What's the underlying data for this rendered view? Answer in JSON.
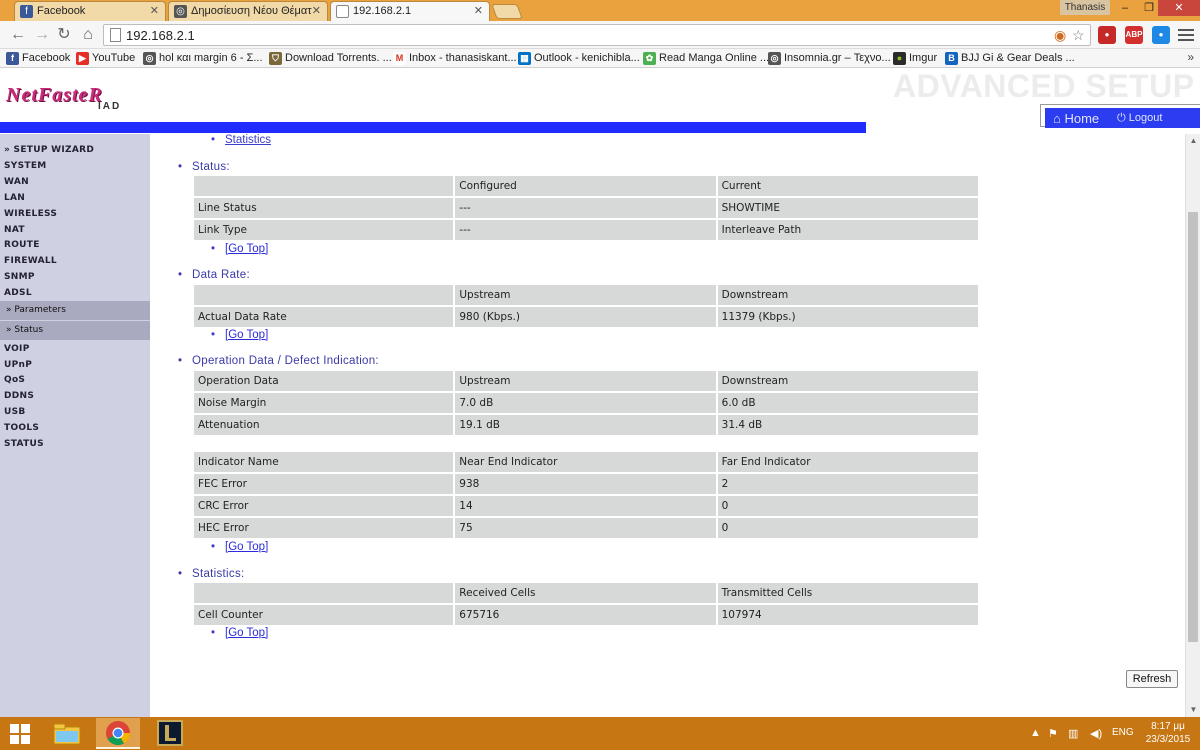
{
  "browser": {
    "tabs": [
      {
        "title": "Facebook",
        "icon": "facebook-icon",
        "color": "#3b5998"
      },
      {
        "title": "Δημοσίευση Νέου Θέματ",
        "icon": "insomnia-icon",
        "color": "#555555"
      },
      {
        "title": "192.168.2.1",
        "icon": "page-icon",
        "color": "#888888"
      }
    ],
    "user_name": "Thanasis",
    "window_controls": {
      "minimize": "–",
      "maximize": "❐",
      "close": "✕"
    },
    "url": "192.168.2.1",
    "extensions": [
      {
        "name": "notification-extension",
        "badge": "1",
        "color": "#c62828"
      },
      {
        "name": "adblock-plus-extension",
        "label": "ABP",
        "badge": "1",
        "color": "#d32f2f"
      },
      {
        "name": "lastpass-extension",
        "badge": "0",
        "color": "#1e88e5"
      }
    ],
    "bookmarks": [
      {
        "label": "Facebook",
        "icon": "facebook-icon",
        "color": "#3b5998"
      },
      {
        "label": "YouTube",
        "icon": "youtube-icon",
        "color": "#e52d27"
      },
      {
        "label": "hol και margin 6 - Σ...",
        "icon": "insomnia-icon",
        "color": "#555555"
      },
      {
        "label": "Download Torrents. ...",
        "icon": "shield-icon",
        "color": "#7a6a3a"
      },
      {
        "label": "Inbox - thanasiskant...",
        "icon": "gmail-icon",
        "color": "#d93025"
      },
      {
        "label": "Outlook - kenichibla...",
        "icon": "outlook-icon",
        "color": "#0072c6"
      },
      {
        "label": "Read Manga Online ...",
        "icon": "manga-icon",
        "color": "#4caf50"
      },
      {
        "label": "Insomnia.gr – Τεχνο...",
        "icon": "insomnia-icon",
        "color": "#555555"
      },
      {
        "label": "Imgur",
        "icon": "imgur-icon",
        "color": "#2b2b2b"
      },
      {
        "label": "BJJ Gi & Gear Deals ...",
        "icon": "bjj-icon",
        "color": "#1565c0"
      }
    ],
    "bookmarks_more": "»"
  },
  "router": {
    "logo": "NetFasteR",
    "logo_sub": "IAD",
    "title": "ADVANCED SETUP",
    "home_label": "Home",
    "logout_label": "Logout"
  },
  "sidebar": {
    "items": [
      "» SETUP WIZARD",
      "SYSTEM",
      "WAN",
      "LAN",
      "WIRELESS",
      "NAT",
      "ROUTE",
      "FIREWALL",
      "SNMP",
      "ADSL"
    ],
    "subitems": [
      "» Parameters",
      "» Status"
    ],
    "items_after": [
      "VOIP",
      "UPnP",
      "QoS",
      "DDNS",
      "USB",
      "TOOLS",
      "STATUS"
    ]
  },
  "content": {
    "top_link": "Statistics",
    "go_top": "[Go Top]",
    "status": {
      "label": "Status:",
      "headers": [
        "",
        "Configured",
        "Current"
      ],
      "rows": [
        [
          "Line Status",
          "---",
          "SHOWTIME"
        ],
        [
          "Link Type",
          "---",
          "Interleave Path"
        ]
      ]
    },
    "data_rate": {
      "label": "Data Rate:",
      "headers": [
        "",
        "Upstream",
        "Downstream"
      ],
      "rows": [
        [
          "Actual Data Rate",
          "980 (Kbps.)",
          "11379 (Kbps.)"
        ]
      ]
    },
    "operation": {
      "label": "Operation Data / Defect Indication:",
      "headers": [
        "Operation Data",
        "Upstream",
        "Downstream"
      ],
      "rows": [
        [
          "Noise Margin",
          "7.0 dB",
          "6.0 dB"
        ],
        [
          "Attenuation",
          "19.1 dB",
          "31.4 dB"
        ]
      ]
    },
    "indicators": {
      "headers": [
        "Indicator Name",
        "Near End Indicator",
        "Far End Indicator"
      ],
      "rows": [
        [
          "FEC Error",
          "938",
          "2"
        ],
        [
          "CRC Error",
          "14",
          "0"
        ],
        [
          "HEC Error",
          "75",
          "0"
        ]
      ]
    },
    "statistics": {
      "label": "Statistics:",
      "headers": [
        "",
        "Received Cells",
        "Transmitted Cells"
      ],
      "rows": [
        [
          "Cell Counter",
          "675716",
          "107974"
        ]
      ]
    },
    "refresh_label": "Refresh"
  },
  "taskbar": {
    "language": "ENG",
    "time": "8:17 μμ",
    "date": "23/3/2015",
    "apps": [
      "file-explorer-icon",
      "chrome-icon",
      "league-of-legends-icon"
    ]
  }
}
